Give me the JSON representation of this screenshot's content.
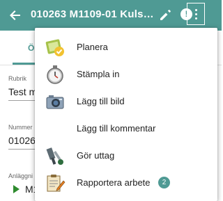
{
  "app_bar": {
    "title": "010263 M1109-01 Kuls…",
    "info_icon_glyph": "!",
    "color": "#4f9a94"
  },
  "tabs": {
    "active_label": "Ö"
  },
  "form": {
    "rubrik_label": "Rubrik",
    "rubrik_value": "Test m",
    "nummer_label": "Nummer",
    "nummer_value": "01026",
    "anlaggning_label": "Anläggni",
    "anlaggning_value": "M1"
  },
  "menu": {
    "items": [
      {
        "label": "Planera",
        "icon": "planner-icon"
      },
      {
        "label": "Stämpla in",
        "icon": "stopwatch-icon"
      },
      {
        "label": "Lägg till bild",
        "icon": "camera-icon"
      },
      {
        "label": "Lägg till kommentar",
        "icon": ""
      },
      {
        "label": "Gör uttag",
        "icon": "tools-icon"
      },
      {
        "label": "Rapportera arbete",
        "icon": "report-icon",
        "badge": "2"
      }
    ]
  }
}
